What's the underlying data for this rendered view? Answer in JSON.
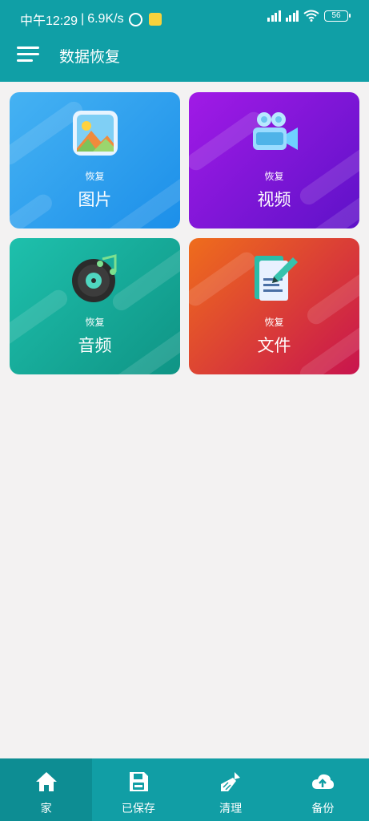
{
  "status_bar": {
    "time": "中午12:29",
    "separator": "|",
    "net_speed": "6.9K/s",
    "battery": "56"
  },
  "header": {
    "title": "数据恢复"
  },
  "cards": [
    {
      "sub": "恢复",
      "title": "图片"
    },
    {
      "sub": "恢复",
      "title": "视频"
    },
    {
      "sub": "恢复",
      "title": "音频"
    },
    {
      "sub": "恢复",
      "title": "文件"
    }
  ],
  "bottom_nav": [
    {
      "label": "家"
    },
    {
      "label": "已保存"
    },
    {
      "label": "清理"
    },
    {
      "label": "备份"
    }
  ],
  "colors": {
    "primary": "#109fa6",
    "background": "#f3f2f2",
    "photos_card": "#2e9ff0",
    "video_card": "#7f16d8",
    "audio_card": "#17ab99",
    "files_card": "#dc3e36"
  }
}
